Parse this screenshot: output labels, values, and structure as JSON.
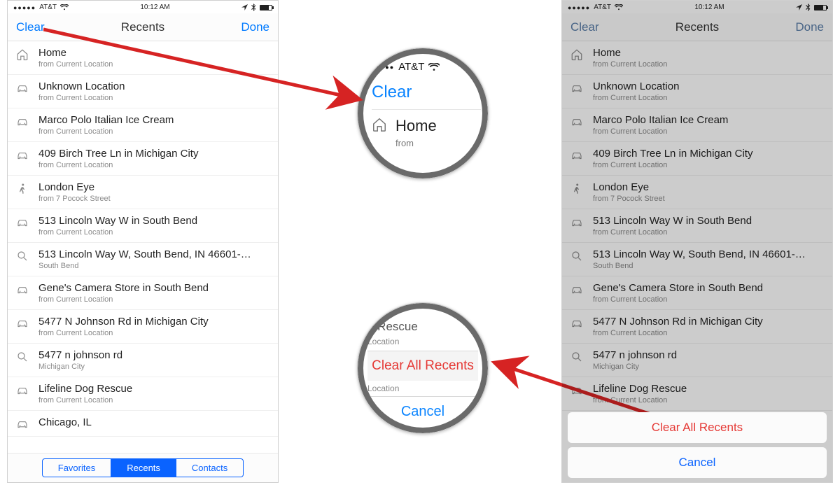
{
  "status": {
    "dots": "●●●●●",
    "carrier": "AT&T",
    "time": "10:12 AM",
    "nav_glyph": "⤢",
    "bt_glyph": "✳︎"
  },
  "nav": {
    "left": "Clear",
    "title": "Recents",
    "right": "Done"
  },
  "segments": {
    "a": "Favorites",
    "b": "Recents",
    "c": "Contacts"
  },
  "rows_left": [
    {
      "icon": "home",
      "title": "Home",
      "sub": "from Current Location"
    },
    {
      "icon": "car",
      "title": "Unknown Location",
      "sub": "from Current Location"
    },
    {
      "icon": "car",
      "title": "Marco Polo Italian Ice Cream",
      "sub": "from Current Location"
    },
    {
      "icon": "car",
      "title": "409 Birch Tree Ln in Michigan City",
      "sub": "from Current Location"
    },
    {
      "icon": "walk",
      "title": "London Eye",
      "sub": "from 7 Pocock Street"
    },
    {
      "icon": "car",
      "title": "513 Lincoln Way W in South Bend",
      "sub": "from Current Location"
    },
    {
      "icon": "search",
      "title": "513 Lincoln Way W, South Bend, IN  46601-…",
      "sub": "South Bend"
    },
    {
      "icon": "car",
      "title": "Gene's Camera Store in South Bend",
      "sub": "from Current Location"
    },
    {
      "icon": "car",
      "title": "5477 N Johnson Rd in Michigan City",
      "sub": "from Current Location"
    },
    {
      "icon": "search",
      "title": "5477 n johnson rd",
      "sub": "Michigan City"
    },
    {
      "icon": "car",
      "title": "Lifeline Dog Rescue",
      "sub": "from Current Location"
    },
    {
      "icon": "car",
      "title": "Chicago, IL",
      "sub": ""
    }
  ],
  "rows_right": [
    {
      "icon": "home",
      "title": "Home",
      "sub": "from Current Location"
    },
    {
      "icon": "car",
      "title": "Unknown Location",
      "sub": "from Current Location"
    },
    {
      "icon": "car",
      "title": "Marco Polo Italian Ice Cream",
      "sub": "from Current Location"
    },
    {
      "icon": "car",
      "title": "409 Birch Tree Ln in Michigan City",
      "sub": "from Current Location"
    },
    {
      "icon": "walk",
      "title": "London Eye",
      "sub": "from 7 Pocock Street"
    },
    {
      "icon": "car",
      "title": "513 Lincoln Way W in South Bend",
      "sub": "from Current Location"
    },
    {
      "icon": "search",
      "title": "513 Lincoln Way W, South Bend, IN  46601-…",
      "sub": "South Bend"
    },
    {
      "icon": "car",
      "title": "Gene's Camera Store in South Bend",
      "sub": "from Current Location"
    },
    {
      "icon": "car",
      "title": "5477 N Johnson Rd in Michigan City",
      "sub": "from Current Location"
    },
    {
      "icon": "search",
      "title": "5477 n johnson rd",
      "sub": "Michigan City"
    },
    {
      "icon": "car",
      "title": "Lifeline Dog Rescue",
      "sub": "from Current Location"
    }
  ],
  "sheet": {
    "clear_all": "Clear All Recents",
    "cancel": "Cancel"
  },
  "mag1": {
    "dots": "●●●●●",
    "carrier": "AT&T",
    "clear": "Clear",
    "home": "Home",
    "from": "from"
  },
  "mag2": {
    "top_title_frag": "g Rescue",
    "top_sub_frag": "Location",
    "clear_all": "Clear All Recents",
    "mid_frag": "Location",
    "cancel": "Cancel"
  }
}
